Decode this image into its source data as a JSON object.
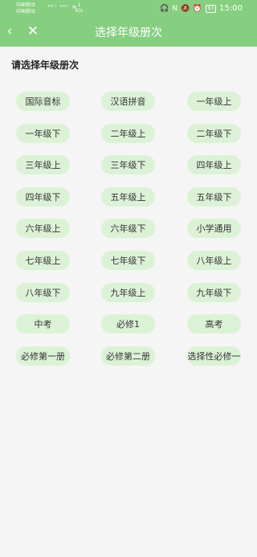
{
  "status_bar": {
    "carrier_1": "中国移动",
    "carrier_2": "中国移动",
    "signal_text": "⁴⁶ᴵˡ ⁴⁶ᴵˡ ≋",
    "speed_value": "1",
    "speed_unit": "K/s",
    "battery": "63",
    "time": "15:00",
    "icons": [
      "headphones-icon",
      "nfc-icon",
      "mute-icon",
      "alarm-icon",
      "battery-icon"
    ]
  },
  "titlebar": {
    "back_icon": "‹",
    "close_icon": "✕",
    "title": "选择年级册次"
  },
  "prompt": "请选择年级册次",
  "options": [
    "国际音标",
    "汉语拼音",
    "一年级上",
    "一年级下",
    "二年级上",
    "二年级下",
    "三年级上",
    "三年级下",
    "四年级上",
    "四年级下",
    "五年级上",
    "五年级下",
    "六年级上",
    "六年级下",
    "小学通用",
    "七年级上",
    "七年级下",
    "八年级上",
    "八年级下",
    "九年级上",
    "九年级下",
    "中考",
    "必修1",
    "高考",
    "必修第一册",
    "必修第二册",
    "选择性必修一"
  ],
  "colors": {
    "header_bg": "#86ce80",
    "chip_bg": "#dcf2d6",
    "page_bg": "#f5f5f5"
  }
}
